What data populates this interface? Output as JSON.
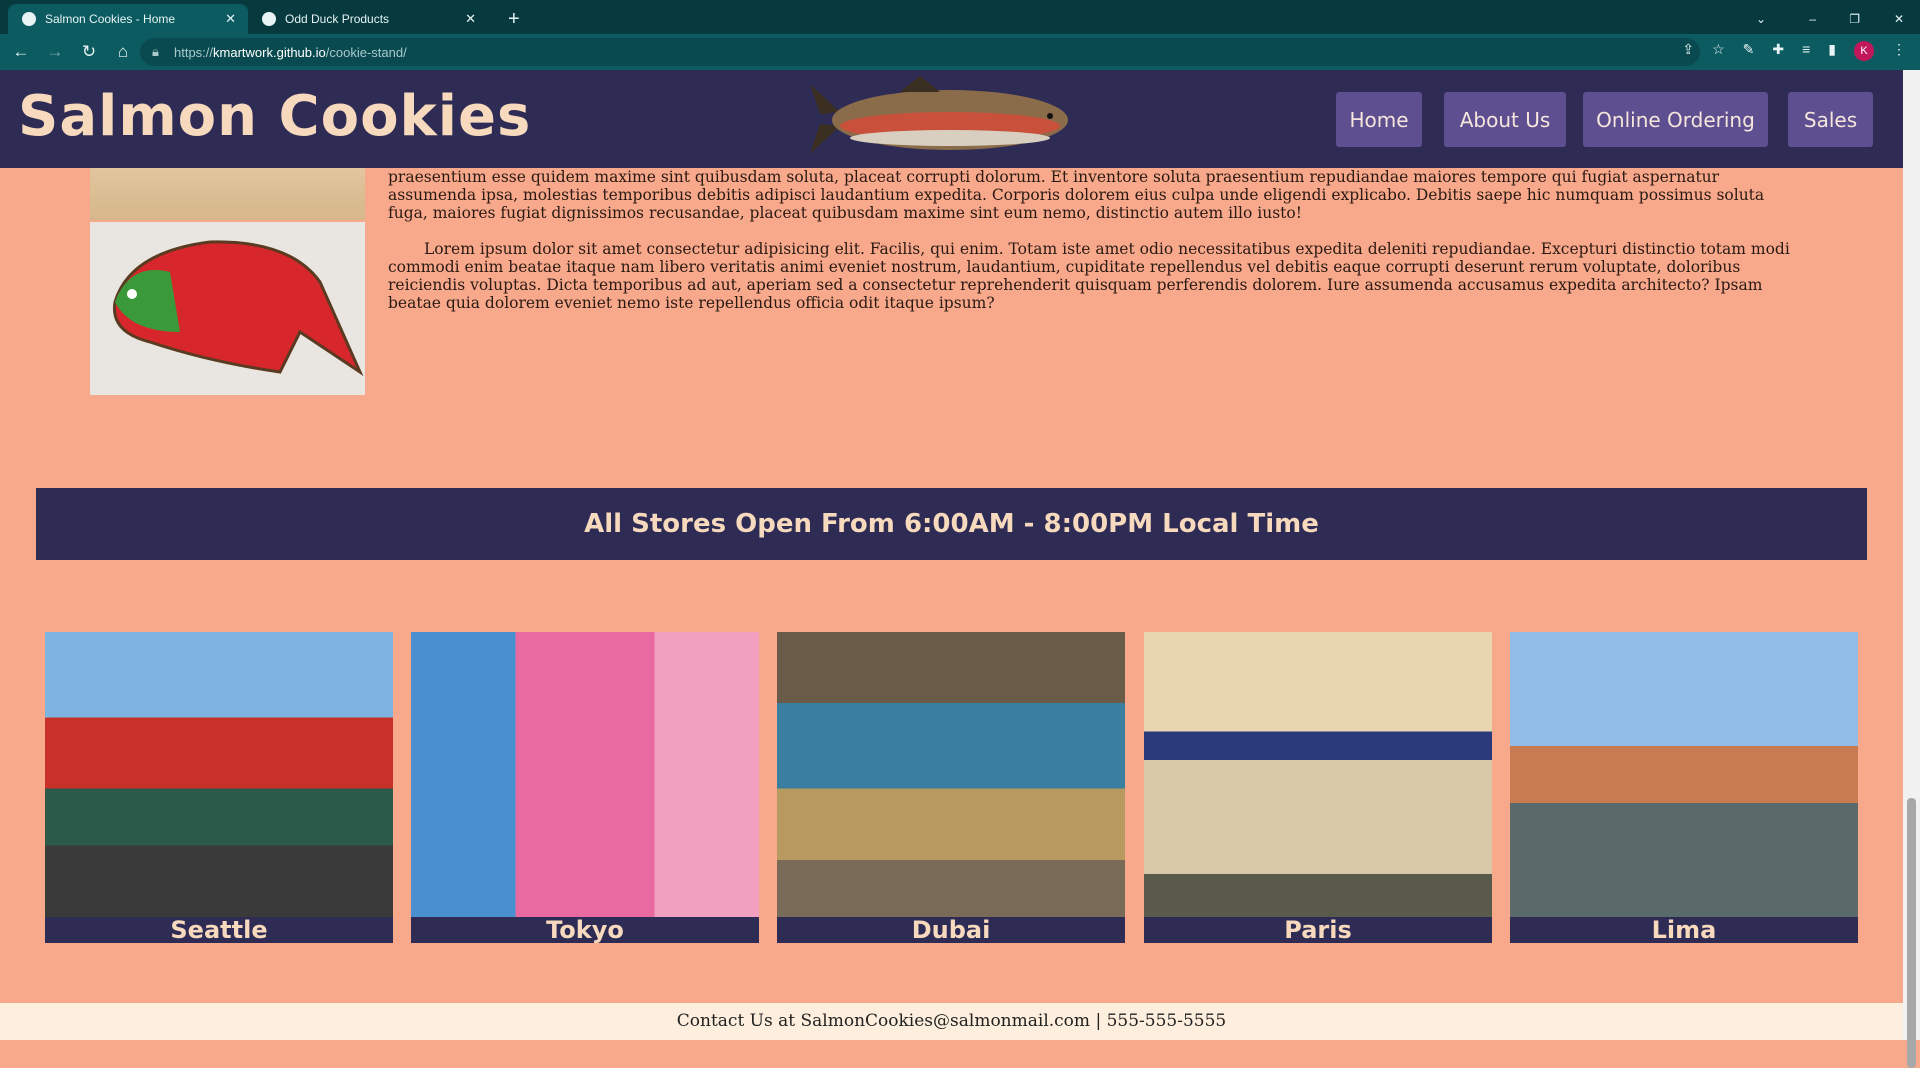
{
  "browser": {
    "tabs": [
      {
        "title": "Salmon Cookies - Home",
        "active": true
      },
      {
        "title": "Odd Duck Products",
        "active": false
      }
    ],
    "url_prefix": "https://",
    "url_host": "kmartwork.github.io",
    "url_path": "/cookie-stand/",
    "profile_initial": "K"
  },
  "header": {
    "title": "Salmon Cookies",
    "nav": [
      "Home",
      "About Us",
      "Online Ordering",
      "Sales"
    ]
  },
  "about": {
    "paragraphs": [
      "praesentium esse quidem maxime sint quibusdam soluta, placeat corrupti dolorum. Et inventore soluta praesentium repudiandae maiores tempore qui fugiat aspernatur assumenda ipsa, molestias temporibus debitis adipisci laudantium expedita. Corporis dolorem eius culpa unde eligendi explicabo. Debitis saepe hic numquam possimus soluta fuga, maiores fugiat dignissimos recusandae, placeat quibusdam maxime sint eum nemo, distinctio autem illo iusto!",
      "Lorem ipsum dolor sit amet consectetur adipisicing elit. Facilis, qui enim. Totam iste amet odio necessitatibus expedita deleniti repudiandae. Excepturi distinctio totam modi commodi enim beatae itaque nam libero veritatis animi eveniet nostrum, laudantium, cupiditate repellendus vel debitis eaque corrupti deserunt rerum voluptate, doloribus reiciendis voluptas. Dicta temporibus ad aut, aperiam sed a consectetur reprehenderit quisquam perferendis dolorem. Iure assumenda accusamus expedita architecto? Ipsam beatae quia dolorem eveniet nemo iste repellendus officia odit itaque ipsum?"
    ]
  },
  "banner": "All Stores Open From 6:00AM - 8:00PM Local Time",
  "stores": [
    "Seattle",
    "Tokyo",
    "Dubai",
    "Paris",
    "Lima"
  ],
  "footer": "Contact Us at SalmonCookies@salmonmail.com | 555-555-5555"
}
